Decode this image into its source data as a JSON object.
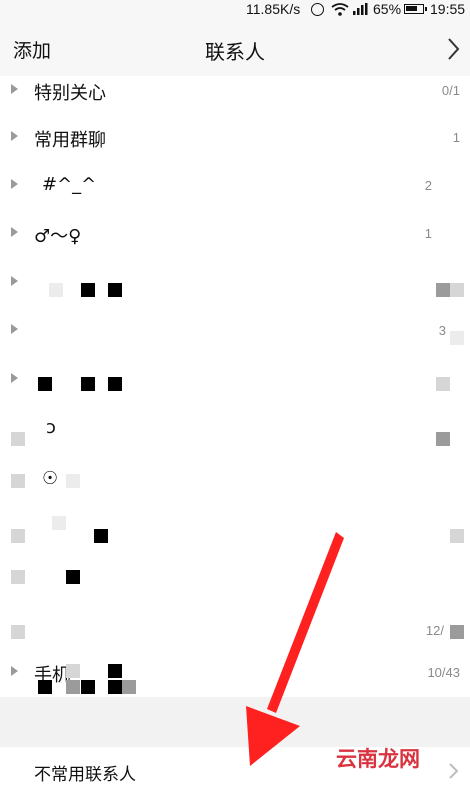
{
  "status_bar": {
    "network_speed": "11.85K/s",
    "battery_percent": "65%",
    "time": "19:55",
    "icons": [
      "alarm-icon",
      "wifi-icon",
      "signal-icon",
      "battery-icon"
    ]
  },
  "header": {
    "add_label": "添加",
    "title": "联系人",
    "more_icon": "chevron-right-icon"
  },
  "groups": [
    {
      "name": "特别关心",
      "count": "0/1"
    },
    {
      "name": "常用群聊",
      "count": "1"
    },
    {
      "name": "#^_^",
      "count": "2"
    },
    {
      "name": "♂～♀",
      "count": "1"
    },
    {
      "name": "",
      "count": ""
    },
    {
      "name": "",
      "count": "3"
    },
    {
      "name": "",
      "count": ""
    },
    {
      "name": "ↄ",
      "count": ""
    },
    {
      "name": "☉",
      "count": ""
    },
    {
      "name": "",
      "count": ""
    },
    {
      "name": "",
      "count": ""
    },
    {
      "name": "",
      "count": "12/"
    },
    {
      "name": "手机",
      "count": "10/43"
    }
  ],
  "footer": {
    "label": "不常用联系人",
    "chevron_icon": "chevron-right-icon"
  },
  "watermark": {
    "text": "云南龙网",
    "color": "#d9333f"
  },
  "annotation_arrow": {
    "color": "#ff2020"
  }
}
